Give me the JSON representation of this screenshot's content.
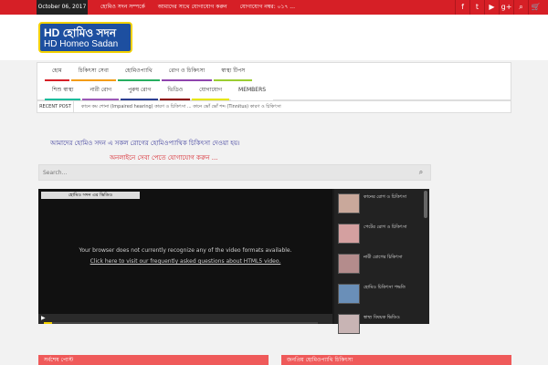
{
  "topbar": {
    "date": "October 06, 2017",
    "links": [
      "হোমিও সদন সম্পর্কে",
      "আমাদের সাথে যোগাযোগ করুন",
      "যোগাযোগ নম্বর: ০১৭ ..."
    ],
    "social_icons": [
      "facebook-icon",
      "twitter-icon",
      "youtube-icon",
      "google-plus-icon",
      "search-icon",
      "cart-icon"
    ]
  },
  "logo": {
    "line1": "HD হোমিও সদন",
    "line2": "HD Homeo Sadan"
  },
  "nav": {
    "row1": [
      "হোম",
      "চিকিৎসা সেবা",
      "হোমিওপ্যাথি",
      "রোগ ও চিকিৎসা",
      "স্বাস্থ্য টিপস"
    ],
    "row2": [
      "শিশু স্বাস্থ্য",
      "নারী রোগ",
      "পুরুষ রোগ",
      "ভিডিও",
      "যোগাযোগ",
      "MEMBERS"
    ]
  },
  "recent": {
    "label": "RECENT POST",
    "text": "কানে কম শোনা (Impaired hearing) কারণ ও চিকিৎসা ... কানে ভোঁ ভোঁ শব্দ (Tinnitus) কারণ ও চিকিৎসা"
  },
  "marquee": {
    "line1": "আমাদের হোমিও সদন এ সকল রোগের হোমিওপ্যাথিক চিকিৎসা দেওয়া হয়।",
    "line2": "অনলাইনে সেবা পেতে যোগাযোগ করুন ..."
  },
  "search": {
    "placeholder": "Search..."
  },
  "video": {
    "title": "হোমিও সদন এর ভিডিও",
    "message": "Your browser does not currently recognize any of the video formats available.",
    "link": "Click here to visit our frequently asked questions about HTML5 video.",
    "progress_percent": 3
  },
  "playlist": [
    {
      "caption": "কানের রোগ ও চিকিৎসা"
    },
    {
      "caption": "পেটের রোগ ও চিকিৎসা"
    },
    {
      "caption": "নারী রোগের চিকিৎসা"
    },
    {
      "caption": "হোমিও চিকিৎসা পদ্ধতি"
    },
    {
      "caption": "স্বাস্থ্য বিষয়ক ভিডিও"
    }
  ],
  "boxes": [
    "সর্বশেষ পোস্ট",
    "জনপ্রিয় হোমিওপ্যাথি চিকিৎসা"
  ]
}
